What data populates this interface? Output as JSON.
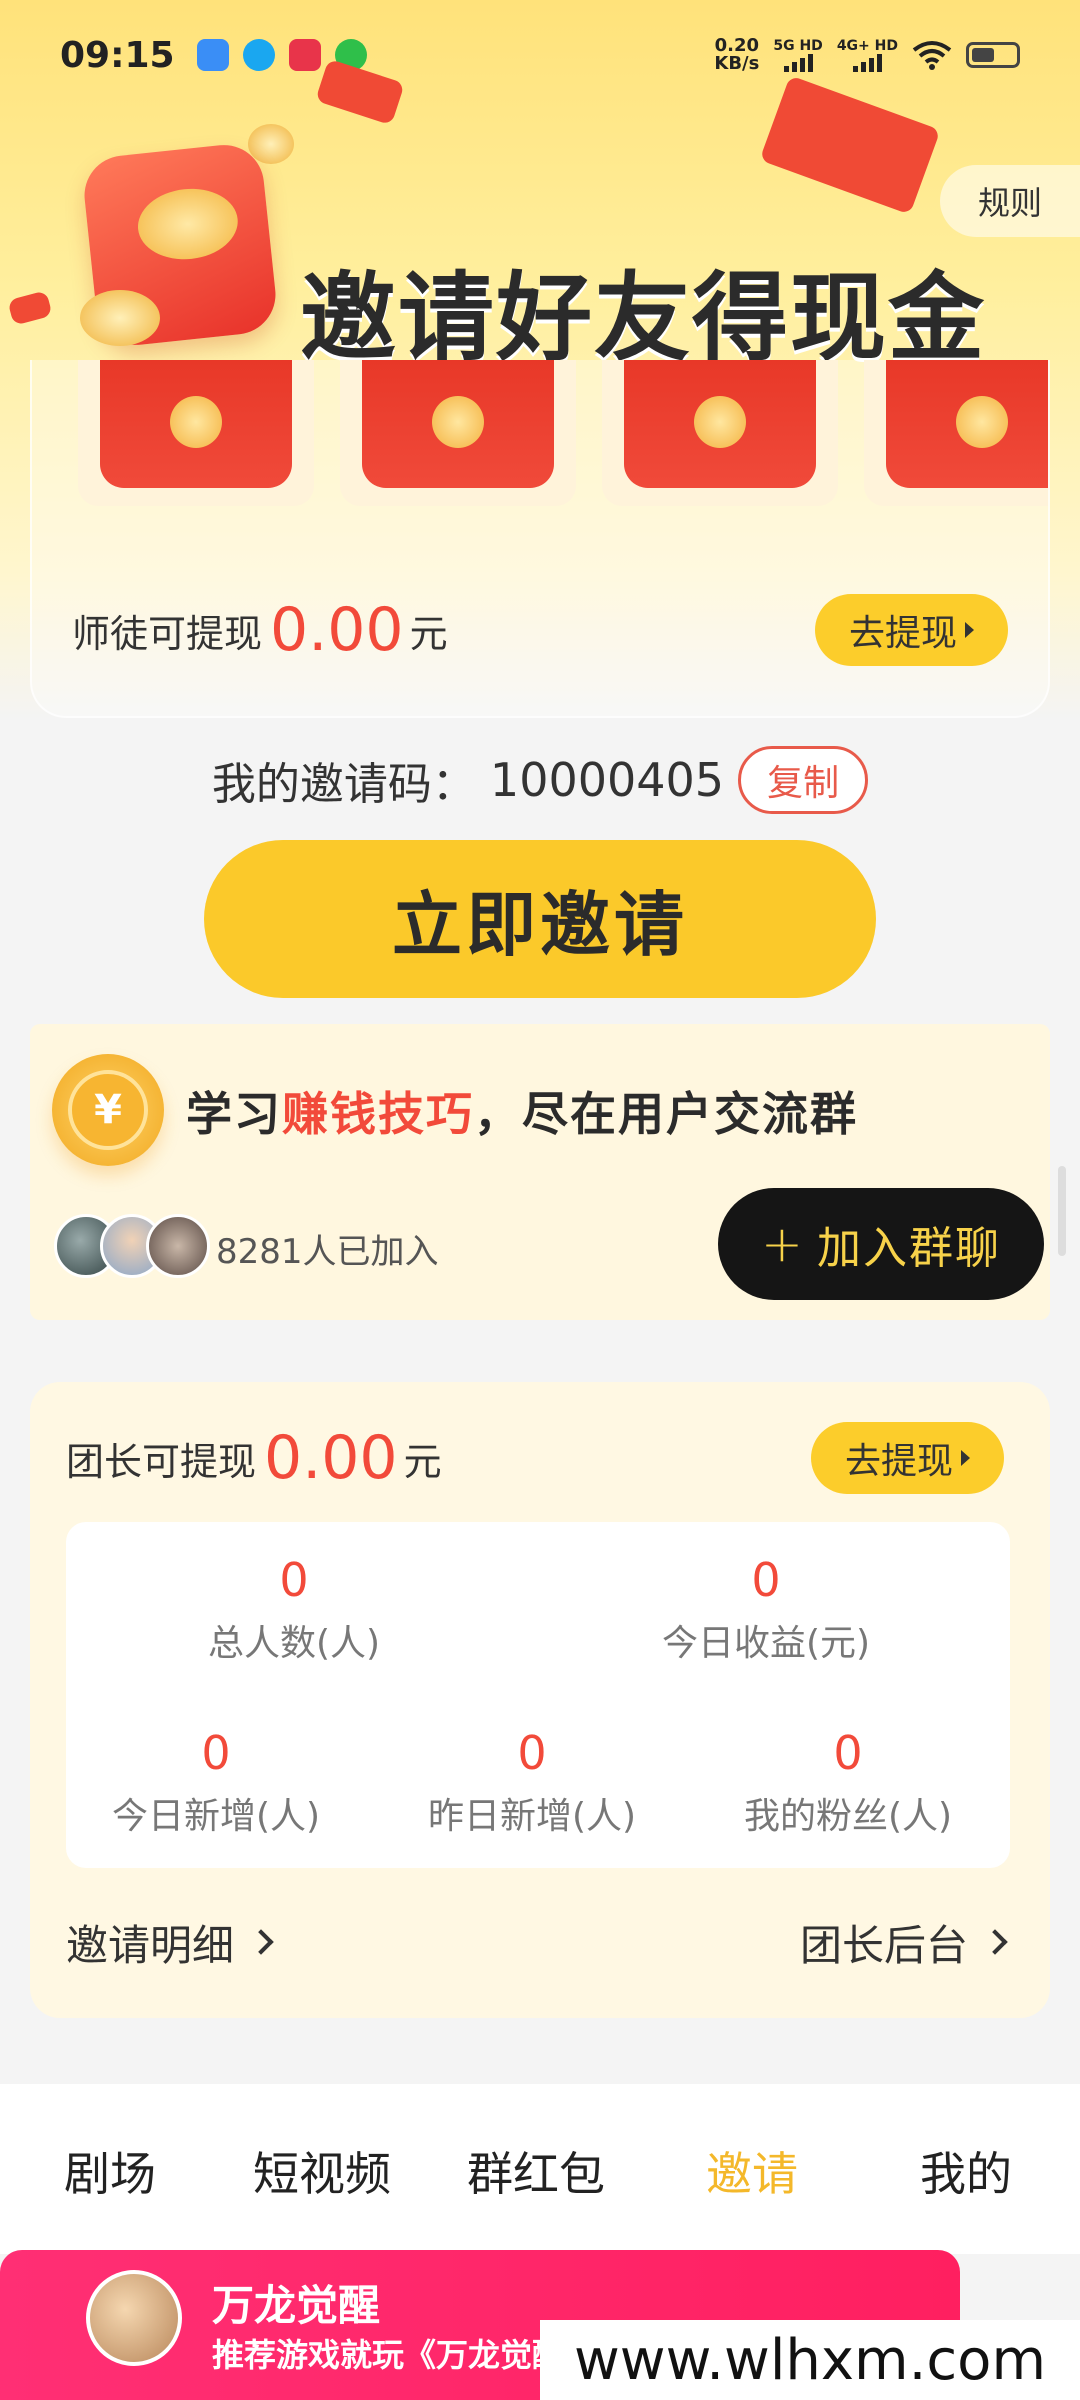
{
  "status_bar": {
    "time": "09:15",
    "net_speed_value": "0.20",
    "net_speed_unit": "KB/s",
    "sim1_label": "5G HD",
    "sim2_label": "4G+ HD",
    "icons": [
      "app-icon-blue",
      "qq-icon",
      "app-icon-red",
      "wechat-icon",
      "wifi-icon",
      "battery-icon"
    ]
  },
  "header": {
    "rules_label": "规则",
    "title": "邀请好友得现金"
  },
  "disciple_withdraw": {
    "label": "师徒可提现",
    "amount": "0.00",
    "unit": "元",
    "button_label": "去提现"
  },
  "invite_code": {
    "label": "我的邀请码：",
    "value": "10000405",
    "copy_label": "复制"
  },
  "invite_button_label": "立即邀请",
  "group": {
    "title_prefix": "学习",
    "title_highlight": "赚钱技巧",
    "title_suffix": "，尽在用户交流群",
    "members_text": "8281人已加入",
    "join_plus": "+",
    "join_label": "加入群聊"
  },
  "team": {
    "withdraw_label": "团长可提现",
    "amount": "0.00",
    "unit": "元",
    "button_label": "去提现",
    "stats": {
      "total_people": {
        "value": "0",
        "label": "总人数(人)"
      },
      "today_income": {
        "value": "0",
        "label": "今日收益(元)"
      },
      "today_new": {
        "value": "0",
        "label": "今日新增(人)"
      },
      "yesterday_new": {
        "value": "0",
        "label": "昨日新增(人)"
      },
      "my_fans": {
        "value": "0",
        "label": "我的粉丝(人)"
      }
    },
    "invite_detail_link": "邀请明细",
    "leader_backend_link": "团长后台"
  },
  "bottom_nav": {
    "items": [
      {
        "label": "剧场"
      },
      {
        "label": "短视频"
      },
      {
        "label": "群红包"
      },
      {
        "label": "邀请"
      },
      {
        "label": "我的"
      }
    ],
    "active_index": 3
  },
  "game_banner": {
    "title": "万龙觉醒",
    "subtitle": "推荐游戏就玩《万龙觉醒》"
  },
  "watermark": "www.wlhxm.com",
  "colors": {
    "accent_yellow": "#fbc92a",
    "accent_red": "#f24a3a",
    "nav_active": "#f4b82a",
    "banner_pink": "#ff2f74"
  }
}
